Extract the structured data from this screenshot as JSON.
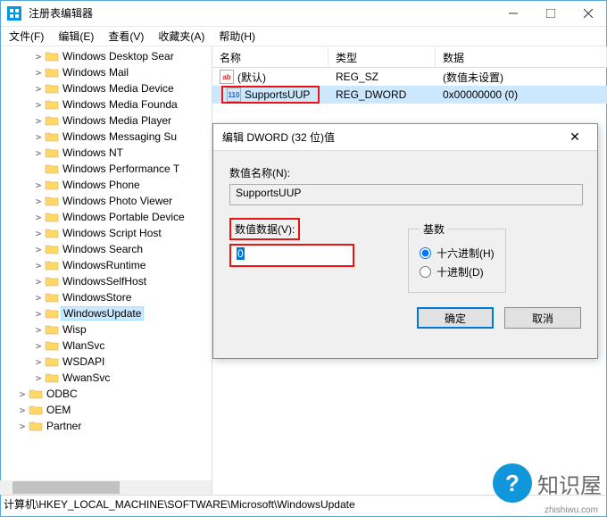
{
  "window": {
    "title": "注册表编辑器"
  },
  "menu": {
    "file": "文件(F)",
    "edit": "编辑(E)",
    "view": "查看(V)",
    "favorites": "收藏夹(A)",
    "help": "帮助(H)"
  },
  "tree": {
    "items": [
      {
        "label": "Windows Desktop Sear",
        "expand": ">",
        "indent": 2
      },
      {
        "label": "Windows Mail",
        "expand": ">",
        "indent": 2
      },
      {
        "label": "Windows Media Device",
        "expand": ">",
        "indent": 2
      },
      {
        "label": "Windows Media Founda",
        "expand": ">",
        "indent": 2
      },
      {
        "label": "Windows Media Player",
        "expand": ">",
        "indent": 2
      },
      {
        "label": "Windows Messaging Su",
        "expand": ">",
        "indent": 2
      },
      {
        "label": "Windows NT",
        "expand": ">",
        "indent": 2
      },
      {
        "label": "Windows Performance T",
        "expand": "",
        "indent": 2
      },
      {
        "label": "Windows Phone",
        "expand": ">",
        "indent": 2
      },
      {
        "label": "Windows Photo Viewer",
        "expand": ">",
        "indent": 2
      },
      {
        "label": "Windows Portable Device",
        "expand": ">",
        "indent": 2
      },
      {
        "label": "Windows Script Host",
        "expand": ">",
        "indent": 2
      },
      {
        "label": "Windows Search",
        "expand": ">",
        "indent": 2
      },
      {
        "label": "WindowsRuntime",
        "expand": ">",
        "indent": 2
      },
      {
        "label": "WindowsSelfHost",
        "expand": ">",
        "indent": 2
      },
      {
        "label": "WindowsStore",
        "expand": ">",
        "indent": 2
      },
      {
        "label": "WindowsUpdate",
        "expand": ">",
        "indent": 2,
        "selected": true
      },
      {
        "label": "Wisp",
        "expand": ">",
        "indent": 2
      },
      {
        "label": "WlanSvc",
        "expand": ">",
        "indent": 2
      },
      {
        "label": "WSDAPI",
        "expand": ">",
        "indent": 2
      },
      {
        "label": "WwanSvc",
        "expand": ">",
        "indent": 2
      },
      {
        "label": "ODBC",
        "expand": ">",
        "indent": 1
      },
      {
        "label": "OEM",
        "expand": ">",
        "indent": 1
      },
      {
        "label": "Partner",
        "expand": ">",
        "indent": 1
      }
    ]
  },
  "list": {
    "headers": {
      "name": "名称",
      "type": "类型",
      "data": "数据"
    },
    "rows": [
      {
        "icon": "str",
        "name": "(默认)",
        "type": "REG_SZ",
        "data": "(数值未设置)",
        "selected": false
      },
      {
        "icon": "dw",
        "name": "SupportsUUP",
        "type": "REG_DWORD",
        "data": "0x00000000 (0)",
        "selected": true,
        "highlight": true
      }
    ]
  },
  "status": {
    "path": "计算机\\HKEY_LOCAL_MACHINE\\SOFTWARE\\Microsoft\\WindowsUpdate"
  },
  "dialog": {
    "title": "编辑 DWORD (32 位)值",
    "name_label": "数值名称(N):",
    "name_value": "SupportsUUP",
    "value_label": "数值数据(V):",
    "value_data": "0",
    "radix_label": "基数",
    "radix_hex": "十六进制(H)",
    "radix_dec": "十进制(D)",
    "ok": "确定",
    "cancel": "取消"
  },
  "watermark": {
    "text": "知识屋",
    "url": "zhishiwu.com"
  }
}
